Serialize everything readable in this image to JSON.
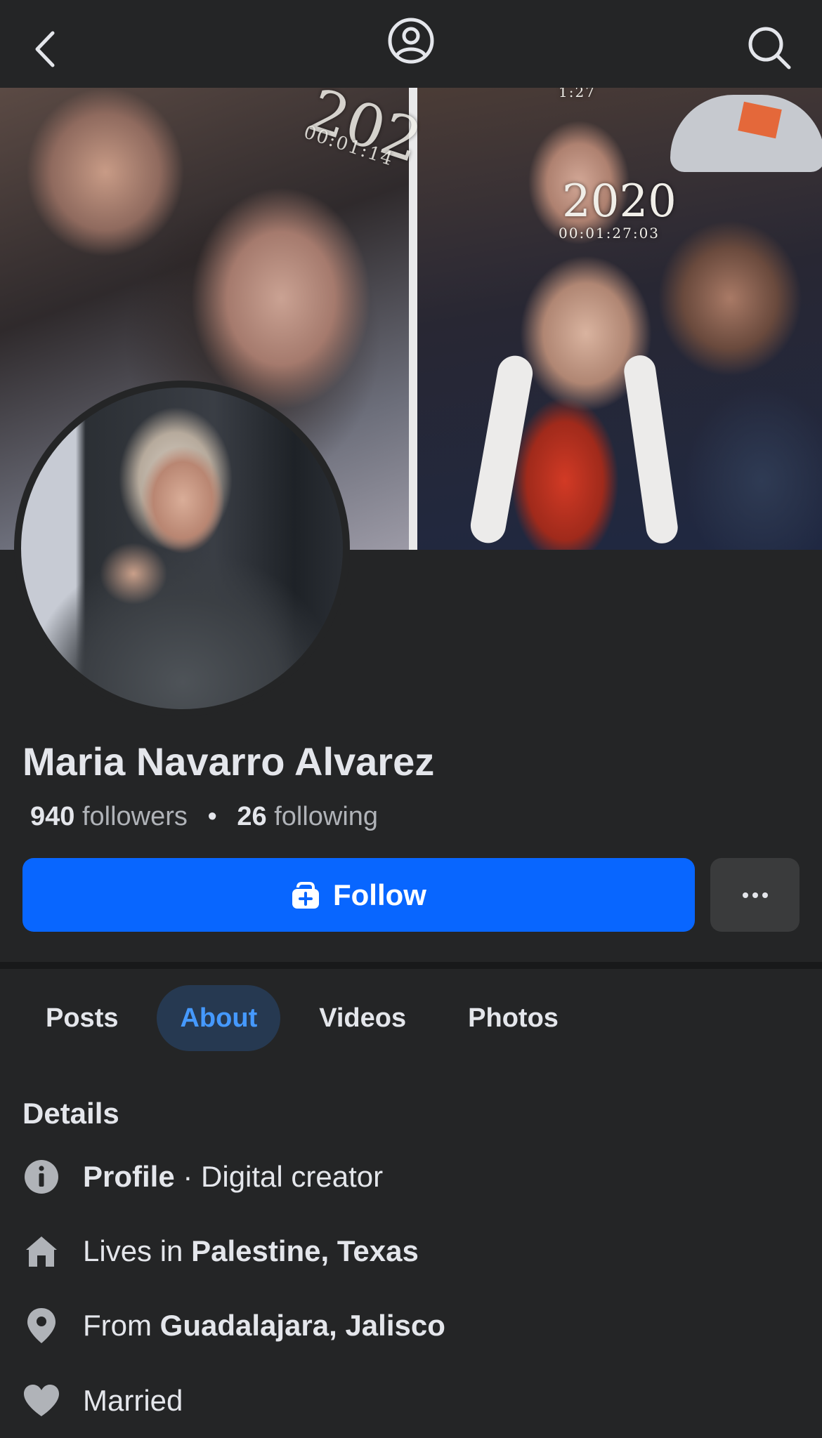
{
  "topbar": {
    "back_icon": "chevron-left-icon",
    "profile_icon": "profile-circle-icon",
    "search_icon": "search-icon"
  },
  "cover": {
    "overlay_year_left": "202",
    "overlay_time_left": "00:01:14",
    "overlay_time_top": "1:27",
    "overlay_year_right": "2020",
    "overlay_time_right": "00:01:27:03"
  },
  "profile": {
    "name": "Maria Navarro Alvarez",
    "followers_count": "940",
    "followers_label": "followers",
    "separator": "•",
    "following_count": "26",
    "following_label": "following"
  },
  "actions": {
    "follow_label": "Follow",
    "more_label": "···"
  },
  "tabs": [
    {
      "label": "Posts",
      "active": false
    },
    {
      "label": "About",
      "active": true
    },
    {
      "label": "Videos",
      "active": false
    },
    {
      "label": "Photos",
      "active": false
    }
  ],
  "details": {
    "title": "Details",
    "rows": [
      {
        "icon": "info-icon",
        "strong": "Profile",
        "text": " · Digital creator"
      },
      {
        "icon": "home-icon",
        "prefix": "Lives in ",
        "strong": "Palestine, Texas"
      },
      {
        "icon": "location-pin-icon",
        "prefix": "From ",
        "strong": "Guadalajara, Jalisco"
      },
      {
        "icon": "heart-icon",
        "text": "Married"
      }
    ]
  },
  "colors": {
    "background": "#242526",
    "primary_button": "#0866ff",
    "active_tab_bg": "#263951",
    "active_tab_text": "#4599ff",
    "secondary_text": "#b0b3b8"
  }
}
